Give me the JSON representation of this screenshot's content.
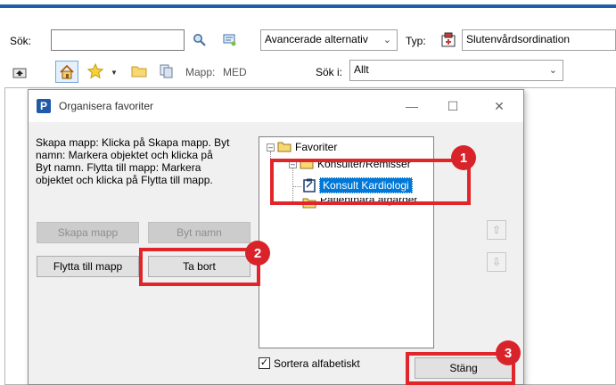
{
  "search": {
    "label": "Sök:",
    "value": "",
    "advanced": "Avancerade alternativ",
    "type_label": "Typ:",
    "type_value": "Slutenvårdsordination",
    "folder_label": "Mapp:",
    "folder_value": "MED",
    "search_in_label": "Sök i:",
    "search_in_value": "Allt"
  },
  "dialog": {
    "title": "Organisera favoriter",
    "app_letter": "P",
    "instructions": "Skapa mapp: Klicka på Skapa mapp. Byt\nnamn: Markera objektet och klicka på\nByt namn. Flytta till mapp: Markera\nobjektet och klicka på Flytta till mapp.",
    "buttons": {
      "create_folder": "Skapa mapp",
      "rename": "Byt namn",
      "move_to_folder": "Flytta till mapp",
      "delete": "Ta bort",
      "close": "Stäng"
    },
    "sort_label": "Sortera alfabetiskt",
    "sort_checked": true,
    "tree": {
      "root": "Favoriter",
      "folder1": "Konsulter/Remisser",
      "item1": "Konsult Kardiologi",
      "folder2": "Patientnära åtgärder"
    }
  },
  "annotations": {
    "one": "1",
    "two": "2",
    "three": "3"
  },
  "colors": {
    "annotation": "#e0262b",
    "selection": "#0078d7",
    "header_blue": "#1f5ea8"
  }
}
